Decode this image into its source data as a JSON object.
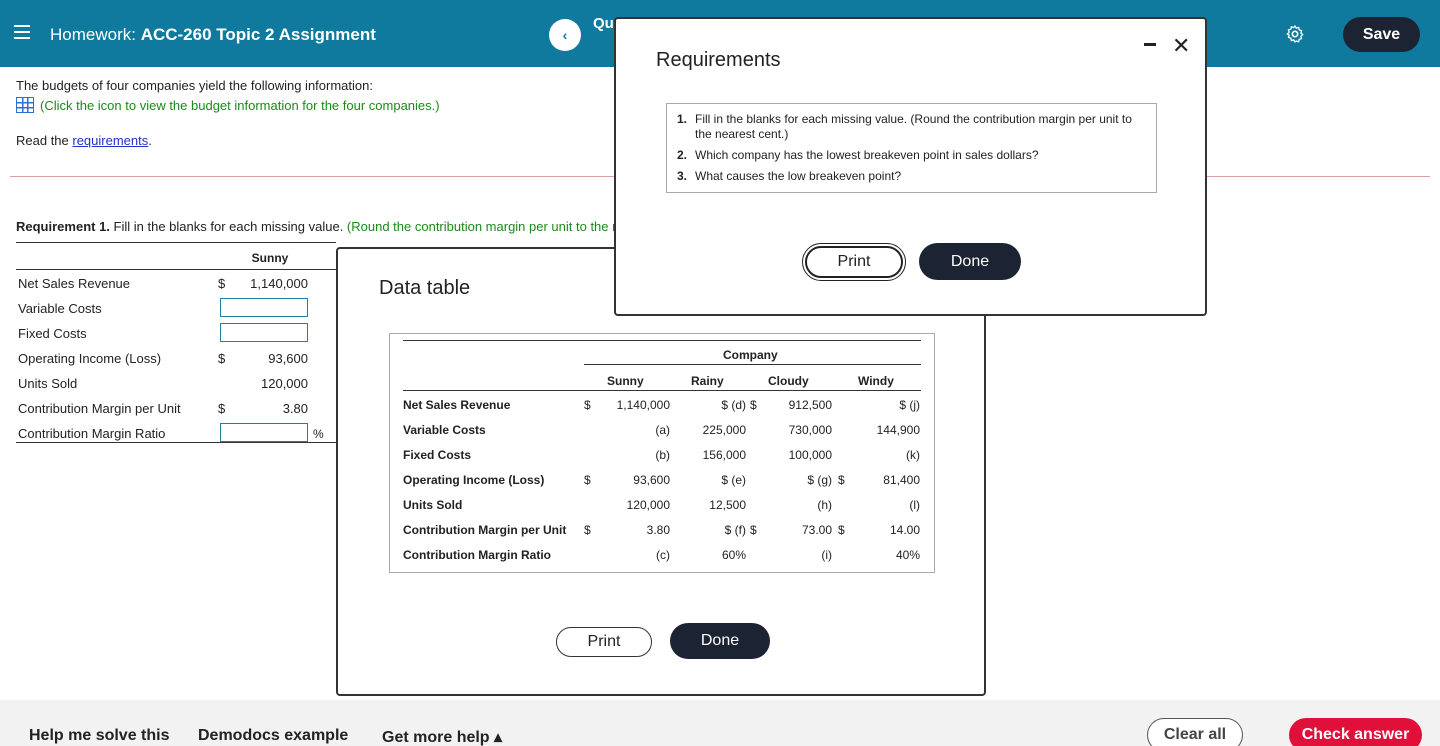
{
  "header": {
    "title_prefix": "Homework: ",
    "title_bold": "ACC-260 Topic 2 Assignment",
    "question_label": "Qu",
    "prev_glyph": "‹",
    "save_label": "Save",
    "bg_color": "#0f7a9e"
  },
  "intro": {
    "text": "The budgets of four companies yield the following information:",
    "click_text": "(Click the icon to view the budget information for the four companies.)",
    "read_prefix": "Read the ",
    "read_link": "requirements",
    "read_suffix": "."
  },
  "requirement1": {
    "bold": "Requirement 1.",
    "text": " Fill in the blanks for each missing value. ",
    "green": "(Round the contribution margin per unit to the nearest cent.)"
  },
  "answer_table": {
    "column": "Sunny",
    "rows": [
      {
        "label": "Net Sales Revenue",
        "sym": "$",
        "value": "1,140,000"
      },
      {
        "label": "Variable Costs",
        "sym": "",
        "value": ""
      },
      {
        "label": "Fixed Costs",
        "sym": "",
        "value": ""
      },
      {
        "label": "Operating Income (Loss)",
        "sym": "$",
        "value": "93,600"
      },
      {
        "label": "Units Sold",
        "sym": "",
        "value": "120,000"
      },
      {
        "label": "Contribution Margin per Unit",
        "sym": "$",
        "value": "3.80"
      },
      {
        "label": "Contribution Margin Ratio",
        "sym": "",
        "value": ""
      }
    ],
    "pct": "%"
  },
  "data_table": {
    "title": "Data table",
    "group_header": "Company",
    "columns": [
      "Sunny",
      "Rainy",
      "Cloudy",
      "Windy"
    ],
    "rows": [
      {
        "label": "Net Sales Revenue",
        "cells": [
          "$",
          "1,140,000",
          "$ (d)",
          "$",
          "912,500",
          "",
          "$ (j)"
        ]
      },
      {
        "label": "Variable Costs",
        "cells": [
          "",
          "(a)",
          "225,000",
          "",
          "730,000",
          "",
          "144,900"
        ]
      },
      {
        "label": "Fixed Costs",
        "cells": [
          "",
          "(b)",
          "156,000",
          "",
          "100,000",
          "",
          "(k)"
        ]
      },
      {
        "label": "Operating Income (Loss)",
        "cells": [
          "$",
          "93,600",
          "$ (e)",
          "",
          "$ (g)",
          "$",
          "81,400"
        ]
      },
      {
        "label": "Units Sold",
        "cells": [
          "",
          "120,000",
          "12,500",
          "",
          "(h)",
          "",
          "(l)"
        ]
      },
      {
        "label": "Contribution Margin per Unit",
        "cells": [
          "$",
          "3.80",
          "$ (f)",
          "$",
          "73.00",
          "$",
          "14.00"
        ]
      },
      {
        "label": "Contribution Margin Ratio",
        "cells": [
          "",
          "(c)",
          "60%",
          "",
          "(i)",
          "",
          "40%"
        ]
      }
    ],
    "print_label": "Print",
    "done_label": "Done"
  },
  "requirements_dialog": {
    "title": "Requirements",
    "items": [
      {
        "num": "1.",
        "text": "Fill in the blanks for each missing value. (Round the contribution margin per unit to the nearest cent.)"
      },
      {
        "num": "2.",
        "text": "Which company has the lowest breakeven point in sales dollars?"
      },
      {
        "num": "3.",
        "text": "What causes the low breakeven point?"
      }
    ],
    "print_label": "Print",
    "done_label": "Done",
    "close_glyph": "✕"
  },
  "footer": {
    "help_label": "Help me solve this",
    "demodocs_label": "Demodocs example",
    "more_help_label": "Get more help ▴",
    "clear_label": "Clear all",
    "check_label": "Check answer",
    "check_color": "#e0103a"
  }
}
